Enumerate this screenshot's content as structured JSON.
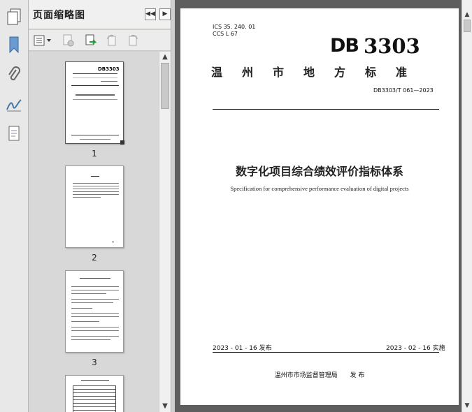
{
  "panel": {
    "title": "页面缩略图",
    "nav_prev": "◀◀",
    "nav_next": "▶"
  },
  "thumbnails": [
    {
      "page_num": "1"
    },
    {
      "page_num": "2"
    },
    {
      "page_num": "3"
    }
  ],
  "document": {
    "ics": "ICS  35. 240. 01",
    "ccs": "CCS  L  67",
    "logo": "DB",
    "code_number": "3303",
    "standard_type": "温　州　市　地　方　标　准",
    "std_number": "DB3303/T  061—2023",
    "title_cn": "数字化项目综合绩效评价指标体系",
    "title_en": "Specification for comprehensive performance evaluation of digital projects",
    "issue_date": "2023 - 01 - 16 发布",
    "implement_date": "2023 - 02 - 16 实施",
    "issuer": "温州市市场监督管理局　　发  布"
  }
}
